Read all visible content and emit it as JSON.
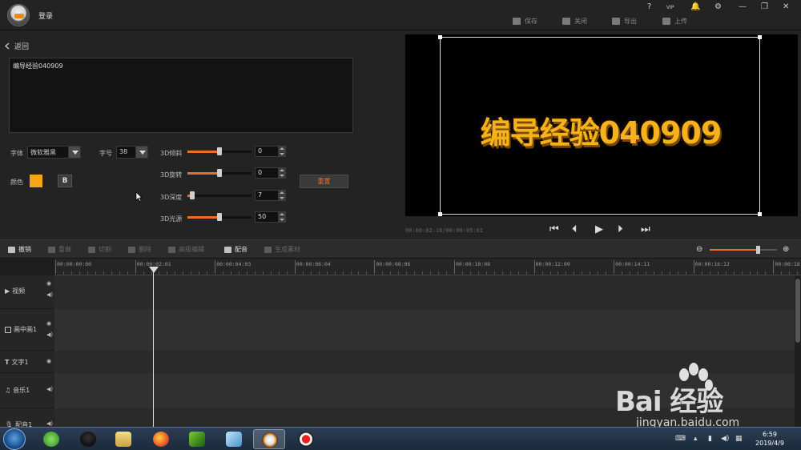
{
  "app": {
    "login": "登录",
    "window_controls": [
      "?",
      "VIP",
      "🔔",
      "⚙",
      "—",
      "❐",
      "✕"
    ]
  },
  "top_actions": [
    {
      "label": "保存",
      "icon": "save-icon"
    },
    {
      "label": "关闭",
      "icon": "close-doc-icon"
    },
    {
      "label": "导出",
      "icon": "export-icon"
    },
    {
      "label": "上传",
      "icon": "upload-icon"
    }
  ],
  "editor": {
    "back_label": "返回",
    "text_value": "编导经验040909",
    "font_label": "字体",
    "font_value": "微软雅黑",
    "size_label": "字号",
    "size_value": "38",
    "color_label": "颜色",
    "color_value": "#f5a614",
    "bold_label": "B",
    "reset_label": "重置",
    "sliders": [
      {
        "label": "3D倾斜",
        "value": "0",
        "fraction": 0.5
      },
      {
        "label": "3D旋转",
        "value": "0",
        "fraction": 0.5
      },
      {
        "label": "3D深度",
        "value": "7",
        "fraction": 0.07
      },
      {
        "label": "3D光源",
        "value": "50",
        "fraction": 0.5
      }
    ]
  },
  "preview": {
    "text": "编导经验040909",
    "timecode": "00:00:02:16/00:00:05:01"
  },
  "toolbar": {
    "tools": [
      {
        "label": "撤销",
        "enabled": true
      },
      {
        "label": "重做",
        "enabled": false
      },
      {
        "label": "切割",
        "enabled": false
      },
      {
        "label": "删除",
        "enabled": false
      },
      {
        "label": "高级编辑",
        "enabled": false
      },
      {
        "label": "配音",
        "enabled": true
      },
      {
        "label": "生成素材",
        "enabled": false
      }
    ],
    "zoom_fraction": 0.7
  },
  "ruler": [
    "00:00:00:00",
    "00:00:02:01",
    "00:00:04:03",
    "00:00:06:04",
    "00:00:08:06",
    "00:00:10:08",
    "00:00:12:09",
    "00:00:14:11",
    "00:00:16:12",
    "00:00:18:"
  ],
  "tracks": [
    {
      "name": "视频",
      "icon": "video-track-icon"
    },
    {
      "name": "画中画1",
      "icon": "pip-track-icon"
    },
    {
      "name": "文字1",
      "icon": "text-track-icon"
    },
    {
      "name": "音乐1",
      "icon": "music-track-icon"
    },
    {
      "name": "配音1",
      "icon": "mic-track-icon"
    }
  ],
  "taskbar": {
    "time": "6:59",
    "date": "2019/4/9"
  },
  "watermark": {
    "brand": "Bai 经验",
    "url": "jingyan.baidu.com"
  }
}
